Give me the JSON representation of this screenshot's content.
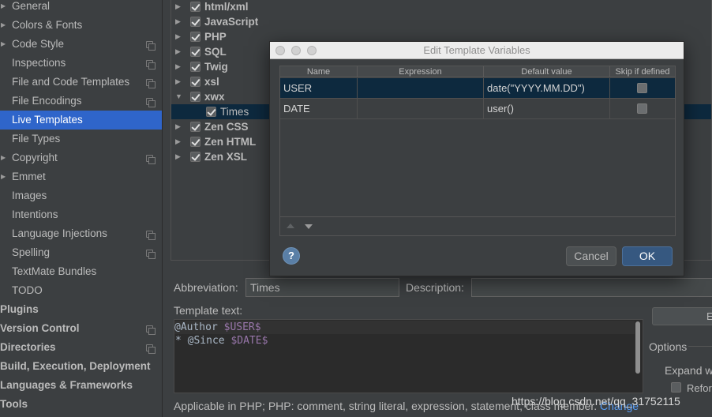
{
  "sidebar": {
    "items": [
      {
        "label": "General",
        "arrow": "▶",
        "indent": 1,
        "icon": false,
        "selected": false
      },
      {
        "label": "Colors & Fonts",
        "arrow": "▶",
        "indent": 1,
        "icon": false,
        "selected": false
      },
      {
        "label": "Code Style",
        "arrow": "▶",
        "indent": 1,
        "icon": true,
        "selected": false
      },
      {
        "label": "Inspections",
        "arrow": "",
        "indent": 1,
        "icon": true,
        "selected": false
      },
      {
        "label": "File and Code Templates",
        "arrow": "",
        "indent": 1,
        "icon": true,
        "selected": false
      },
      {
        "label": "File Encodings",
        "arrow": "",
        "indent": 1,
        "icon": true,
        "selected": false
      },
      {
        "label": "Live Templates",
        "arrow": "",
        "indent": 1,
        "icon": false,
        "selected": true
      },
      {
        "label": "File Types",
        "arrow": "",
        "indent": 1,
        "icon": false,
        "selected": false
      },
      {
        "label": "Copyright",
        "arrow": "▶",
        "indent": 1,
        "icon": true,
        "selected": false
      },
      {
        "label": "Emmet",
        "arrow": "▶",
        "indent": 1,
        "icon": false,
        "selected": false
      },
      {
        "label": "Images",
        "arrow": "",
        "indent": 1,
        "icon": false,
        "selected": false
      },
      {
        "label": "Intentions",
        "arrow": "",
        "indent": 1,
        "icon": false,
        "selected": false
      },
      {
        "label": "Language Injections",
        "arrow": "",
        "indent": 1,
        "icon": true,
        "selected": false
      },
      {
        "label": "Spelling",
        "arrow": "",
        "indent": 1,
        "icon": true,
        "selected": false
      },
      {
        "label": "TextMate Bundles",
        "arrow": "",
        "indent": 1,
        "icon": false,
        "selected": false
      },
      {
        "label": "TODO",
        "arrow": "",
        "indent": 1,
        "icon": false,
        "selected": false
      },
      {
        "label": "Plugins",
        "arrow": "",
        "indent": 0,
        "icon": false,
        "selected": false
      },
      {
        "label": "Version Control",
        "arrow": "",
        "indent": 0,
        "icon": true,
        "selected": false
      },
      {
        "label": "Directories",
        "arrow": "",
        "indent": 0,
        "icon": true,
        "selected": false
      },
      {
        "label": "Build, Execution, Deployment",
        "arrow": "",
        "indent": 0,
        "icon": false,
        "selected": false
      },
      {
        "label": "Languages & Frameworks",
        "arrow": "",
        "indent": 0,
        "icon": false,
        "selected": false
      },
      {
        "label": "Tools",
        "arrow": "",
        "indent": 0,
        "icon": false,
        "selected": false
      }
    ]
  },
  "template_tree": {
    "groups": [
      {
        "label": "html/xml",
        "toggle": "▶",
        "child": false,
        "selected": false
      },
      {
        "label": "JavaScript",
        "toggle": "▶",
        "child": false,
        "selected": false
      },
      {
        "label": "PHP",
        "toggle": "▶",
        "child": false,
        "selected": false
      },
      {
        "label": "SQL",
        "toggle": "▶",
        "child": false,
        "selected": false
      },
      {
        "label": "Twig",
        "toggle": "▶",
        "child": false,
        "selected": false
      },
      {
        "label": "xsl",
        "toggle": "▶",
        "child": false,
        "selected": false
      },
      {
        "label": "xwx",
        "toggle": "▼",
        "child": false,
        "selected": false
      },
      {
        "label": "Times",
        "toggle": "",
        "child": true,
        "selected": true
      },
      {
        "label": "Zen CSS",
        "toggle": "▶",
        "child": false,
        "selected": false
      },
      {
        "label": "Zen HTML",
        "toggle": "▶",
        "child": false,
        "selected": false
      },
      {
        "label": "Zen XSL",
        "toggle": "▶",
        "child": false,
        "selected": false
      }
    ]
  },
  "editor": {
    "abbreviation_label": "Abbreviation:",
    "abbreviation_value": "Times",
    "description_label": "Description:",
    "description_value": "",
    "template_text_label": "Template text:",
    "template_lines": [
      {
        "prefix": "@Author ",
        "var": "$USER$"
      },
      {
        "prefix": "* @Since ",
        "var": "$DATE$"
      }
    ],
    "edit_button_label": "E",
    "options_label": "Options",
    "expand_label": "Expand w",
    "reformat_label": "Refor",
    "applicable_text": "Applicable in PHP; PHP: comment, string literal, expression, statement, class member.",
    "change_link": "Change",
    "watermark": "https://blog.csdn.net/qq_31752115"
  },
  "dialog": {
    "title": "Edit Template Variables",
    "columns": [
      "Name",
      "Expression",
      "Default value",
      "Skip if defined"
    ],
    "rows": [
      {
        "name": "USER",
        "expression": "",
        "default_value": "date(\"YYYY.MM.DD\")",
        "skip": false,
        "selected": true
      },
      {
        "name": "DATE",
        "expression": "",
        "default_value": "user()",
        "skip": false,
        "selected": false
      }
    ],
    "help_label": "?",
    "cancel_label": "Cancel",
    "ok_label": "OK"
  },
  "colors": {
    "background": "#3c3f41",
    "selection": "#2f65ca",
    "tree_selection": "#0d293e",
    "template_variable": "#9876aa",
    "link": "#589df6"
  }
}
